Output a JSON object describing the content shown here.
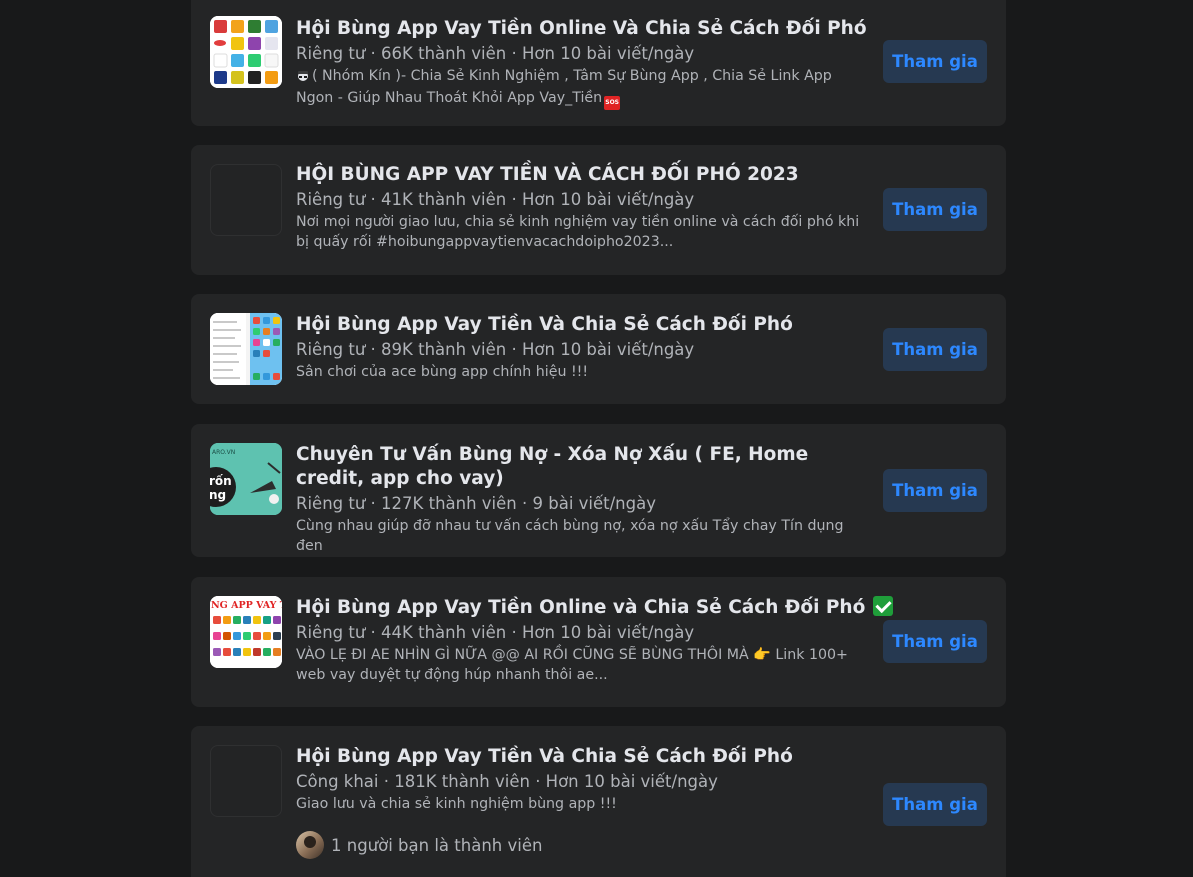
{
  "colors": {
    "background": "#18191a",
    "card": "#242526",
    "primary_text": "#e4e6eb",
    "secondary_text": "#b0b3b8",
    "button_bg": "#263951",
    "button_text": "#2d88ff"
  },
  "groups": [
    {
      "name": "Hội Bùng App Vay Tiền Online Và Chia Sẻ Cách Đối Phó",
      "meta": "Riêng tư · 66K thành viên · Hơn 10 bài viết/ngày",
      "description": "( Nhóm Kín )- Chia Sẻ Kinh Nghiệm , Tâm Sự Bùng App , Chia Sẻ Link App Ngon - Giúp Nhau Thoát Khỏi App Vay_Tiền",
      "description_lead_icon": "spy-emoji-icon",
      "description_trail_icon": "sos-emoji-icon",
      "thumbnail": "app-grid-image",
      "join_label": "Tham gia"
    },
    {
      "name": "HỘI BÙNG APP VAY TIỀN VÀ CÁCH ĐỐI PHÓ 2023",
      "meta": "Riêng tư · 41K thành viên · Hơn 10 bài viết/ngày",
      "description": "Nơi mọi người giao lưu, chia sẻ kinh nghiệm vay tiền online và cách đối phó khi bị quấy rối #hoibungappvaytienvacachdoipho2023...",
      "thumbnail": "empty",
      "join_label": "Tham gia"
    },
    {
      "name": "Hội Bùng App Vay Tiền Và Chia Sẻ Cách Đối Phó",
      "meta": "Riêng tư · 89K thành viên · Hơn 10 bài viết/ngày",
      "description": "Sân chơi của ace bùng app chính hiệu !!!",
      "thumbnail": "phone-screenshot-image",
      "join_label": "Tham gia"
    },
    {
      "name": "Chuyên Tư Vấn Bùng Nợ - Xóa Nợ Xấu ( FE, Home credit, app cho vay)",
      "meta": "Riêng tư · 127K thành viên · 9 bài viết/ngày",
      "description": "Cùng nhau giúp đỡ nhau tư vấn cách bùng nợ, xóa nợ xấu Tẩy chay Tín dụng đen",
      "thumbnail": "teal-banner-image",
      "thumbnail_text": "ARO.VN",
      "join_label": "Tham gia"
    },
    {
      "name": "Hội Bùng App Vay Tiền Online và Chia Sẻ Cách Đối Phó",
      "name_trail_icon": "check-mark-emoji-icon",
      "meta": "Riêng tư · 44K thành viên · Hơn 10 bài viết/ngày",
      "description": "VÀO LẸ ĐI AE NHÌN GÌ NỮA @@ AI RỒI CŨNG SẼ BÙNG THÔI MÀ 👉 Link 100+ web vay duyệt tự động húp nhanh thôi ae...",
      "thumbnail": "app-list-image",
      "thumbnail_text": "NG APP VAY T",
      "join_label": "Tham gia"
    },
    {
      "name": "Hội Bùng App Vay Tiền Và Chia Sẻ Cách Đối Phó",
      "meta": "Công khai · 181K thành viên · Hơn 10 bài viết/ngày",
      "description": "Giao lưu và chia sẻ kinh nghiệm bùng app !!!",
      "thumbnail": "empty",
      "friends_text": "1 người bạn là thành viên",
      "join_label": "Tham gia"
    }
  ]
}
